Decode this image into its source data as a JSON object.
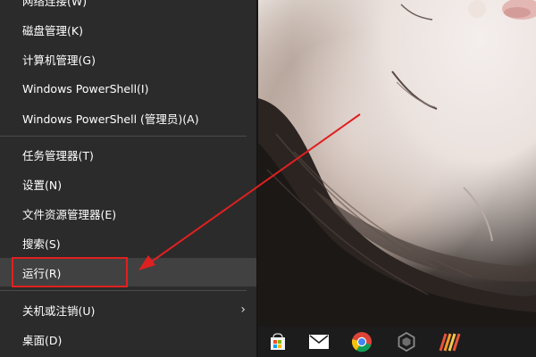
{
  "menu": {
    "items": [
      {
        "label": "网络连接(W)"
      },
      {
        "label": "磁盘管理(K)"
      },
      {
        "label": "计算机管理(G)"
      },
      {
        "label": "Windows PowerShell(I)"
      },
      {
        "label": "Windows PowerShell (管理员)(A)"
      },
      {
        "label": "任务管理器(T)"
      },
      {
        "label": "设置(N)"
      },
      {
        "label": "文件资源管理器(E)"
      },
      {
        "label": "搜索(S)"
      },
      {
        "label": "运行(R)"
      },
      {
        "label": "关机或注销(U)",
        "submenu_arrow": "›"
      },
      {
        "label": "桌面(D)"
      }
    ]
  },
  "annotation": {
    "color": "#e02020",
    "highlighted_item": "运行(R)"
  },
  "taskbar": {
    "icons": [
      "store-icon",
      "mail-icon",
      "chrome-icon",
      "settings-icon",
      "office-app-icon"
    ]
  }
}
